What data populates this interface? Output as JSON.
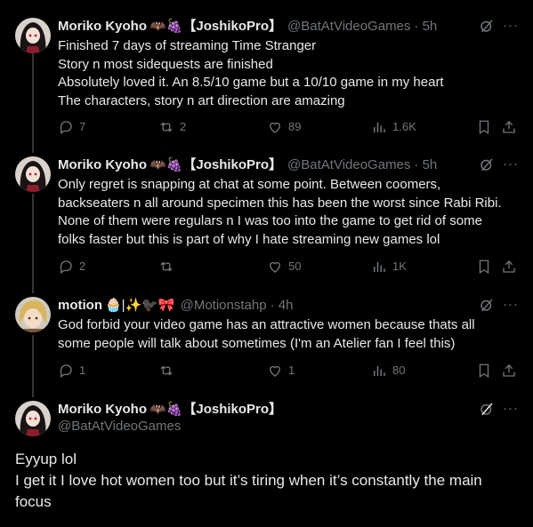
{
  "posts": [
    {
      "name": "Moriko Kyoho",
      "emoji": "🦇🍇",
      "tag": "【JoshikoPro】",
      "handle": "@BatAtVideoGames",
      "time": "· 5h",
      "lines": [
        "Finished 7 days of streaming Time Stranger",
        "Story n most sidequests are finished",
        "Absolutely loved it. An 8.5/10 game but a 10/10 game in my heart",
        "The characters, story n art direction are amazing"
      ],
      "replies": "7",
      "reposts": "2",
      "likes": "89",
      "views": "1.6K"
    },
    {
      "name": "Moriko Kyoho",
      "emoji": "🦇🍇",
      "tag": "【JoshikoPro】",
      "handle": "@BatAtVideoGames",
      "time": "· 5h",
      "lines": [
        "Only regret is snapping at chat at some point. Between coomers,",
        "backseaters n all around specimen this has been the worst since Rabi Ribi.",
        "None of them were regulars n I was too into the game to get rid of some",
        "folks faster but this is part of why I hate streaming new games lol"
      ],
      "replies": "2",
      "reposts": "",
      "likes": "50",
      "views": "1K"
    },
    {
      "name": "motion",
      "emoji": "🧁|✨🐦‍⬛🎀",
      "tag": "",
      "handle": "@Motionstahp",
      "time": "· 4h",
      "lines": [
        "God forbid your video game has an attractive women because thats all",
        "some people will talk about sometimes (I'm an Atelier fan I feel this)"
      ],
      "replies": "1",
      "reposts": "",
      "likes": "1",
      "views": "80"
    }
  ],
  "main_post": {
    "name": "Moriko Kyoho",
    "emoji": "🦇🍇",
    "tag": "【JoshikoPro】",
    "handle": "@BatAtVideoGames",
    "lines": [
      "Eyyup lol",
      "I get it I love hot women too but it’s tiring when it’s constantly the main",
      "focus"
    ]
  },
  "icons": [
    "reply-icon",
    "repost-icon",
    "like-icon",
    "views-icon",
    "bookmark-icon",
    "share-icon",
    "grok-icon",
    "more-icon"
  ],
  "colors": {
    "background": "#000000",
    "text": "#e7e9ea",
    "muted": "#71767b",
    "line": "#333639"
  }
}
